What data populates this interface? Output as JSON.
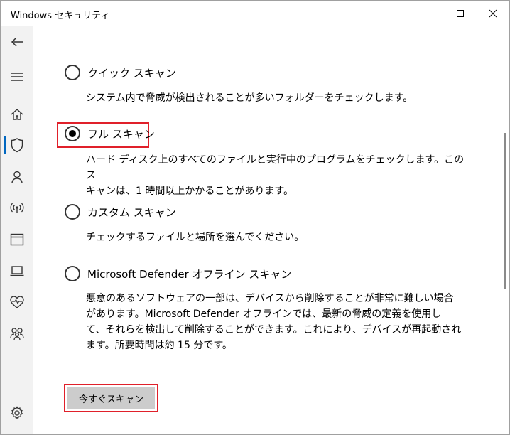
{
  "window": {
    "title": "Windows セキュリティ"
  },
  "rail": {
    "items": [
      {
        "icon": "back-arrow-icon"
      },
      {
        "icon": "hamburger-menu-icon"
      },
      {
        "icon": "home-icon"
      },
      {
        "icon": "shield-icon",
        "active": true
      },
      {
        "icon": "person-icon"
      },
      {
        "icon": "wireless-icon"
      },
      {
        "icon": "app-browser-icon"
      },
      {
        "icon": "laptop-icon"
      },
      {
        "icon": "heart-pulse-icon"
      },
      {
        "icon": "family-icon"
      },
      {
        "icon": "settings-gear-icon"
      }
    ]
  },
  "scan_options": [
    {
      "label": "クイック スキャン",
      "selected": false,
      "description": [
        "システム内で脅威が検出されることが多いフォルダーをチェックします。"
      ]
    },
    {
      "label": "フル スキャン",
      "selected": true,
      "description": [
        "ハード ディスク上のすべてのファイルと実行中のプログラムをチェックします。このス",
        "キャンは、1 時間以上かかることがあります。"
      ]
    },
    {
      "label": "カスタム スキャン",
      "selected": false,
      "description": [
        "チェックするファイルと場所を選んでください。"
      ]
    },
    {
      "label": "Microsoft Defender オフライン スキャン",
      "selected": false,
      "description": [
        "悪意のあるソフトウェアの一部は、デバイスから削除することが非常に難しい場合",
        "があります。Microsoft Defender オフラインでは、最新の脅威の定義を使用し",
        "て、それらを検出して削除することができます。これにより、デバイスが再起動され",
        "ます。所要時間は約 15 分です。"
      ]
    }
  ],
  "scan_button": {
    "label": "今すぐスキャン"
  },
  "colors": {
    "accent": "#0067c0",
    "highlight": "#e0202a",
    "rail_bg": "#f2f2f2",
    "button_bg": "#cccccc"
  }
}
